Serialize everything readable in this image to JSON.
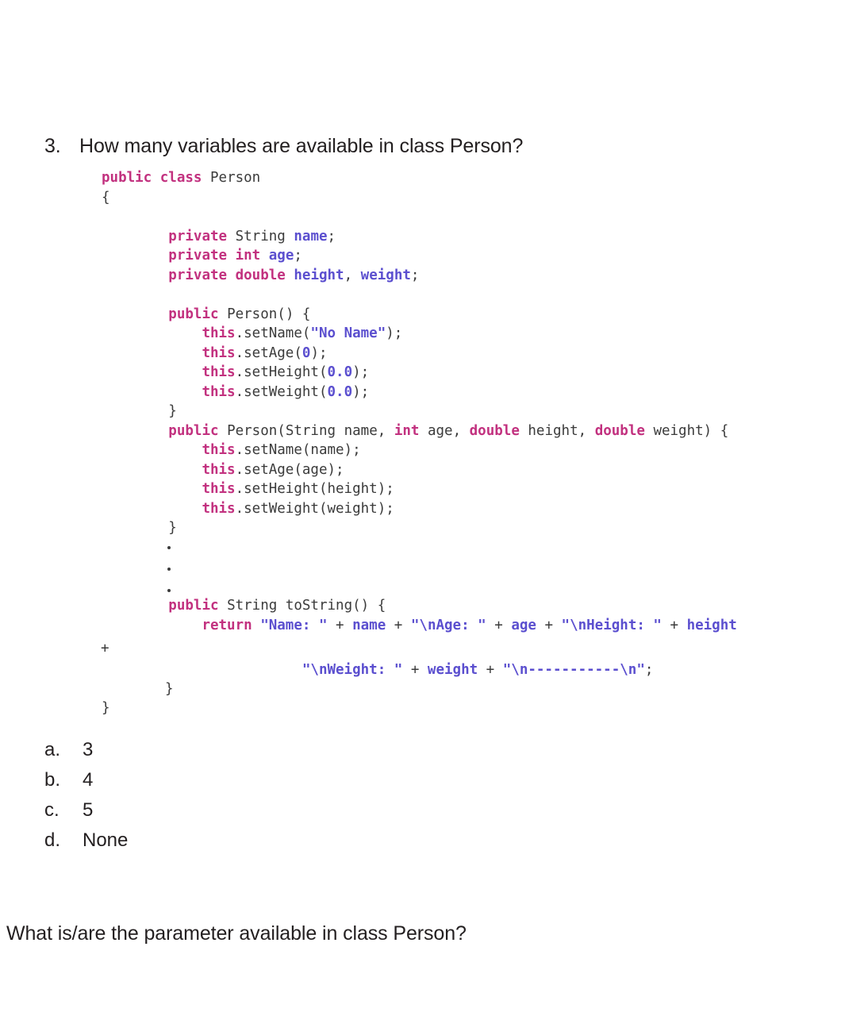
{
  "question": {
    "number": "3.",
    "text": "How many variables are available in class Person?"
  },
  "code": {
    "language": "java",
    "lines": [
      {
        "indent": 0,
        "tokens": [
          {
            "t": "public",
            "c": "kw"
          },
          {
            "t": " ",
            "c": "pln"
          },
          {
            "t": "class",
            "c": "kw"
          },
          {
            "t": " ",
            "c": "pln"
          },
          {
            "t": "Person",
            "c": "typ"
          }
        ]
      },
      {
        "indent": 0,
        "tokens": [
          {
            "t": "{",
            "c": "pln"
          }
        ]
      },
      {
        "indent": 0,
        "tokens": [
          {
            "t": "",
            "c": "pln"
          }
        ]
      },
      {
        "indent": 8,
        "tokens": [
          {
            "t": "private",
            "c": "kw"
          },
          {
            "t": " ",
            "c": "pln"
          },
          {
            "t": "String",
            "c": "typ"
          },
          {
            "t": " ",
            "c": "pln"
          },
          {
            "t": "name",
            "c": "var"
          },
          {
            "t": ";",
            "c": "pln"
          }
        ]
      },
      {
        "indent": 8,
        "tokens": [
          {
            "t": "private",
            "c": "kw"
          },
          {
            "t": " ",
            "c": "pln"
          },
          {
            "t": "int",
            "c": "kw"
          },
          {
            "t": " ",
            "c": "pln"
          },
          {
            "t": "age",
            "c": "var"
          },
          {
            "t": ";",
            "c": "pln"
          }
        ]
      },
      {
        "indent": 8,
        "tokens": [
          {
            "t": "private",
            "c": "kw"
          },
          {
            "t": " ",
            "c": "pln"
          },
          {
            "t": "double",
            "c": "kw"
          },
          {
            "t": " ",
            "c": "pln"
          },
          {
            "t": "height",
            "c": "var"
          },
          {
            "t": ", ",
            "c": "pln"
          },
          {
            "t": "weight",
            "c": "var"
          },
          {
            "t": ";",
            "c": "pln"
          }
        ]
      },
      {
        "indent": 0,
        "tokens": [
          {
            "t": "",
            "c": "pln"
          }
        ]
      },
      {
        "indent": 8,
        "tokens": [
          {
            "t": "public",
            "c": "kw"
          },
          {
            "t": " ",
            "c": "pln"
          },
          {
            "t": "Person() {",
            "c": "pln"
          }
        ]
      },
      {
        "indent": 12,
        "tokens": [
          {
            "t": "this",
            "c": "kw"
          },
          {
            "t": ".setName(",
            "c": "pln"
          },
          {
            "t": "\"No Name\"",
            "c": "str"
          },
          {
            "t": ");",
            "c": "pln"
          }
        ]
      },
      {
        "indent": 12,
        "tokens": [
          {
            "t": "this",
            "c": "kw"
          },
          {
            "t": ".setAge(",
            "c": "pln"
          },
          {
            "t": "0",
            "c": "num"
          },
          {
            "t": ");",
            "c": "pln"
          }
        ]
      },
      {
        "indent": 12,
        "tokens": [
          {
            "t": "this",
            "c": "kw"
          },
          {
            "t": ".setHeight(",
            "c": "pln"
          },
          {
            "t": "0.0",
            "c": "num"
          },
          {
            "t": ");",
            "c": "pln"
          }
        ]
      },
      {
        "indent": 12,
        "tokens": [
          {
            "t": "this",
            "c": "kw"
          },
          {
            "t": ".setWeight(",
            "c": "pln"
          },
          {
            "t": "0.0",
            "c": "num"
          },
          {
            "t": ");",
            "c": "pln"
          }
        ]
      },
      {
        "indent": 8,
        "tokens": [
          {
            "t": "}",
            "c": "pln"
          }
        ]
      },
      {
        "indent": 8,
        "tokens": [
          {
            "t": "public",
            "c": "kw"
          },
          {
            "t": " ",
            "c": "pln"
          },
          {
            "t": "Person(",
            "c": "pln"
          },
          {
            "t": "String",
            "c": "typ"
          },
          {
            "t": " name, ",
            "c": "pln"
          },
          {
            "t": "int",
            "c": "kw"
          },
          {
            "t": " age, ",
            "c": "pln"
          },
          {
            "t": "double",
            "c": "kw"
          },
          {
            "t": " height, ",
            "c": "pln"
          },
          {
            "t": "double",
            "c": "kw"
          },
          {
            "t": " weight) {",
            "c": "pln"
          }
        ]
      },
      {
        "indent": 12,
        "tokens": [
          {
            "t": "this",
            "c": "kw"
          },
          {
            "t": ".setName(name);",
            "c": "pln"
          }
        ]
      },
      {
        "indent": 12,
        "tokens": [
          {
            "t": "this",
            "c": "kw"
          },
          {
            "t": ".setAge(age);",
            "c": "pln"
          }
        ]
      },
      {
        "indent": 12,
        "tokens": [
          {
            "t": "this",
            "c": "kw"
          },
          {
            "t": ".setHeight(height);",
            "c": "pln"
          }
        ]
      },
      {
        "indent": 12,
        "tokens": [
          {
            "t": "this",
            "c": "kw"
          },
          {
            "t": ".setWeight(weight);",
            "c": "pln"
          }
        ]
      },
      {
        "indent": 8,
        "tokens": [
          {
            "t": "}",
            "c": "pln"
          }
        ]
      },
      {
        "indent": 0,
        "tokens": [
          {
            "t": "",
            "c": "pln"
          }
        ]
      },
      {
        "indent": 0,
        "tokens": [
          {
            "t": "",
            "c": "pln"
          }
        ]
      },
      {
        "indent": 0,
        "tokens": [
          {
            "t": "",
            "c": "pln"
          }
        ]
      },
      {
        "indent": 8,
        "tokens": [
          {
            "t": "public",
            "c": "kw"
          },
          {
            "t": " ",
            "c": "pln"
          },
          {
            "t": "String",
            "c": "typ"
          },
          {
            "t": " toString() {",
            "c": "pln"
          }
        ]
      },
      {
        "indent": 12,
        "tokens": [
          {
            "t": "return",
            "c": "kw"
          },
          {
            "t": " ",
            "c": "pln"
          },
          {
            "t": "\"Name: \"",
            "c": "str"
          },
          {
            "t": " + ",
            "c": "pln"
          },
          {
            "t": "name",
            "c": "var"
          },
          {
            "t": " + ",
            "c": "pln"
          },
          {
            "t": "\"\\nAge: \"",
            "c": "str"
          },
          {
            "t": " + ",
            "c": "pln"
          },
          {
            "t": "age",
            "c": "var"
          },
          {
            "t": " + ",
            "c": "pln"
          },
          {
            "t": "\"\\nHeight: \"",
            "c": "str"
          },
          {
            "t": " + ",
            "c": "pln"
          },
          {
            "t": "height",
            "c": "var"
          }
        ]
      }
    ],
    "ellipsis_dots": 3,
    "wrap_plus": "+",
    "return_wrap_tokens": [
      {
        "t": "\"\\nWeight: \"",
        "c": "str"
      },
      {
        "t": " + ",
        "c": "pln"
      },
      {
        "t": "weight",
        "c": "var"
      },
      {
        "t": " + ",
        "c": "pln"
      },
      {
        "t": "\"\\n-----------\\n\"",
        "c": "str"
      },
      {
        "t": ";",
        "c": "pln"
      }
    ],
    "closing_brace_method": "}",
    "closing_brace_class": "}"
  },
  "options": [
    {
      "letter": "a.",
      "text": "3"
    },
    {
      "letter": "b.",
      "text": "4"
    },
    {
      "letter": "c.",
      "text": "5"
    },
    {
      "letter": "d.",
      "text": "None"
    }
  ],
  "footer_question": "What is/are the parameter available in class Person?",
  "colors": {
    "page_background": "#ffffff",
    "body_text": "#231f20",
    "code_default": "#3b3b3b",
    "keyword": "#c2317f",
    "identifier": "#5b4fcf",
    "string_literal": "#5b4fcf"
  }
}
